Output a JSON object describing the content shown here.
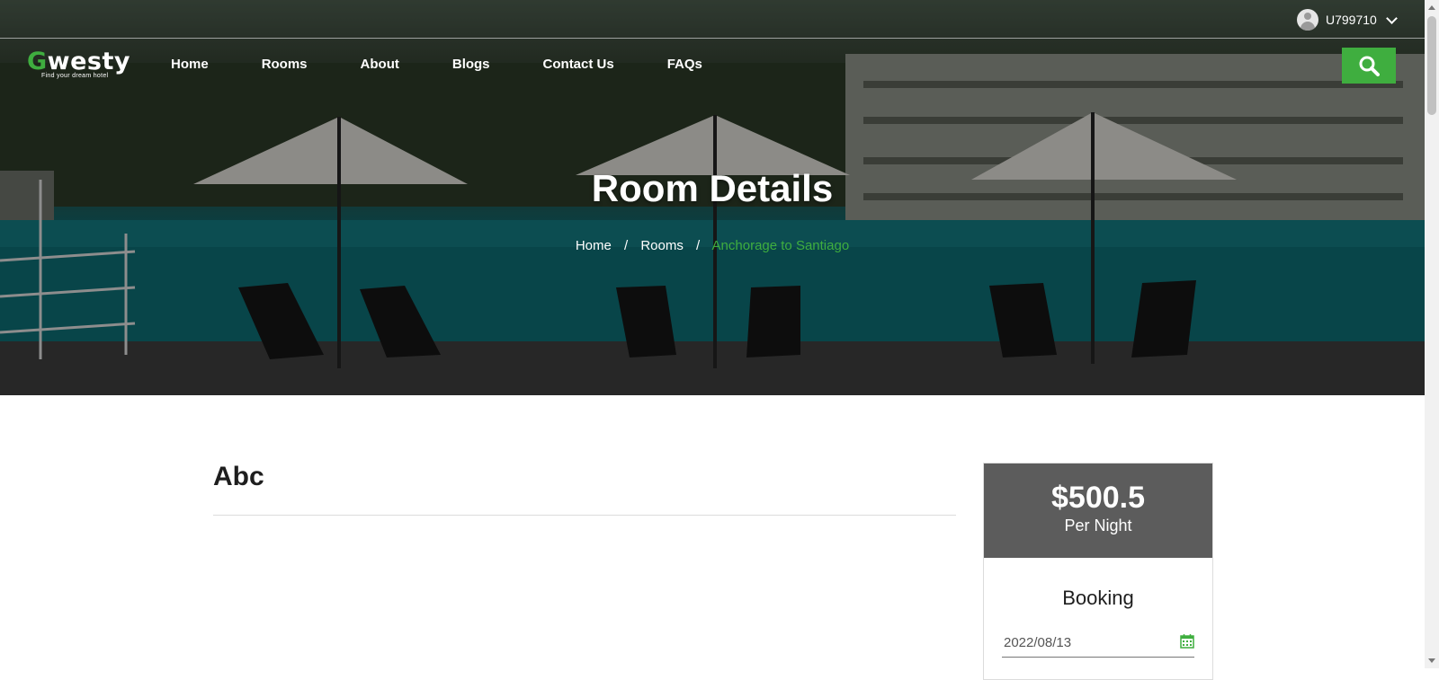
{
  "user": {
    "id": "U799710"
  },
  "logo": {
    "name_first_letter": "G",
    "name_rest": "westy",
    "tagline": "Find your dream hotel"
  },
  "nav": {
    "items": [
      "Home",
      "Rooms",
      "About",
      "Blogs",
      "Contact Us",
      "FAQs"
    ]
  },
  "hero": {
    "title": "Room Details",
    "breadcrumb": {
      "home": "Home",
      "separator": "/",
      "rooms": "Rooms",
      "current": "Anchorage to Santiago"
    }
  },
  "room": {
    "name": "Abc"
  },
  "pricing": {
    "price": "$500.5",
    "unit": "Per Night"
  },
  "booking": {
    "title": "Booking",
    "date_value": "2022/08/13"
  },
  "colors": {
    "accent": "#3fae3f",
    "price_box": "#5c5c5c"
  },
  "icons": {
    "user": "user-avatar-icon",
    "dropdown": "chevron-down-icon",
    "search": "search-icon",
    "calendar": "calendar-icon"
  }
}
